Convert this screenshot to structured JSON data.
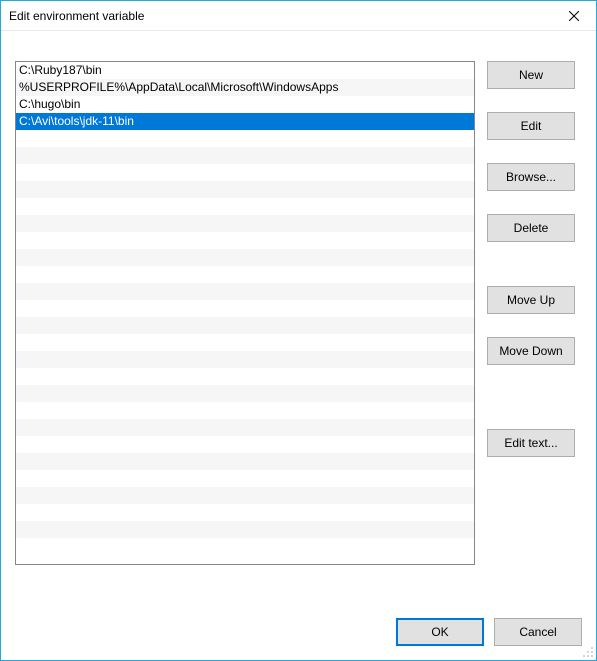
{
  "window": {
    "title": "Edit environment variable"
  },
  "list": {
    "items": [
      {
        "path": "C:\\Ruby187\\bin",
        "selected": false
      },
      {
        "path": "%USERPROFILE%\\AppData\\Local\\Microsoft\\WindowsApps",
        "selected": false
      },
      {
        "path": "C:\\hugo\\bin",
        "selected": false
      },
      {
        "path": "C:\\Avi\\tools\\jdk-11\\bin",
        "selected": true
      }
    ],
    "visible_rows": 29
  },
  "buttons": {
    "new": "New",
    "edit": "Edit",
    "browse": "Browse...",
    "delete": "Delete",
    "move_up": "Move Up",
    "move_down": "Move Down",
    "edit_text": "Edit text..."
  },
  "footer": {
    "ok": "OK",
    "cancel": "Cancel"
  }
}
